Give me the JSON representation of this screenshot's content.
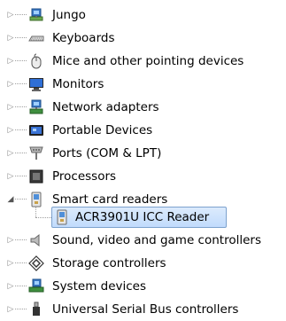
{
  "tree": {
    "nodes": [
      {
        "label": "Jungo",
        "icon": "jungo-device-icon",
        "state": "collapsed"
      },
      {
        "label": "Keyboards",
        "icon": "keyboard-icon",
        "state": "collapsed"
      },
      {
        "label": "Mice and other pointing devices",
        "icon": "mouse-icon",
        "state": "collapsed"
      },
      {
        "label": "Monitors",
        "icon": "monitor-icon",
        "state": "collapsed"
      },
      {
        "label": "Network adapters",
        "icon": "network-adapter-icon",
        "state": "collapsed"
      },
      {
        "label": "Portable Devices",
        "icon": "portable-device-icon",
        "state": "collapsed"
      },
      {
        "label": "Ports (COM & LPT)",
        "icon": "port-icon",
        "state": "collapsed"
      },
      {
        "label": "Processors",
        "icon": "processor-icon",
        "state": "collapsed"
      },
      {
        "label": "Smart card readers",
        "icon": "smart-card-reader-icon",
        "state": "expanded",
        "children": [
          {
            "label": "ACR3901U ICC Reader",
            "icon": "smart-card-reader-icon",
            "selected": true
          }
        ]
      },
      {
        "label": "Sound, video and game controllers",
        "icon": "speaker-icon",
        "state": "collapsed"
      },
      {
        "label": "Storage controllers",
        "icon": "storage-controller-icon",
        "state": "collapsed"
      },
      {
        "label": "System devices",
        "icon": "system-device-icon",
        "state": "collapsed"
      },
      {
        "label": "Universal Serial Bus controllers",
        "icon": "usb-icon",
        "state": "collapsed"
      }
    ]
  },
  "colors": {
    "selection_border": "#7da2ce",
    "selection_fill": "#c1dbfc"
  }
}
